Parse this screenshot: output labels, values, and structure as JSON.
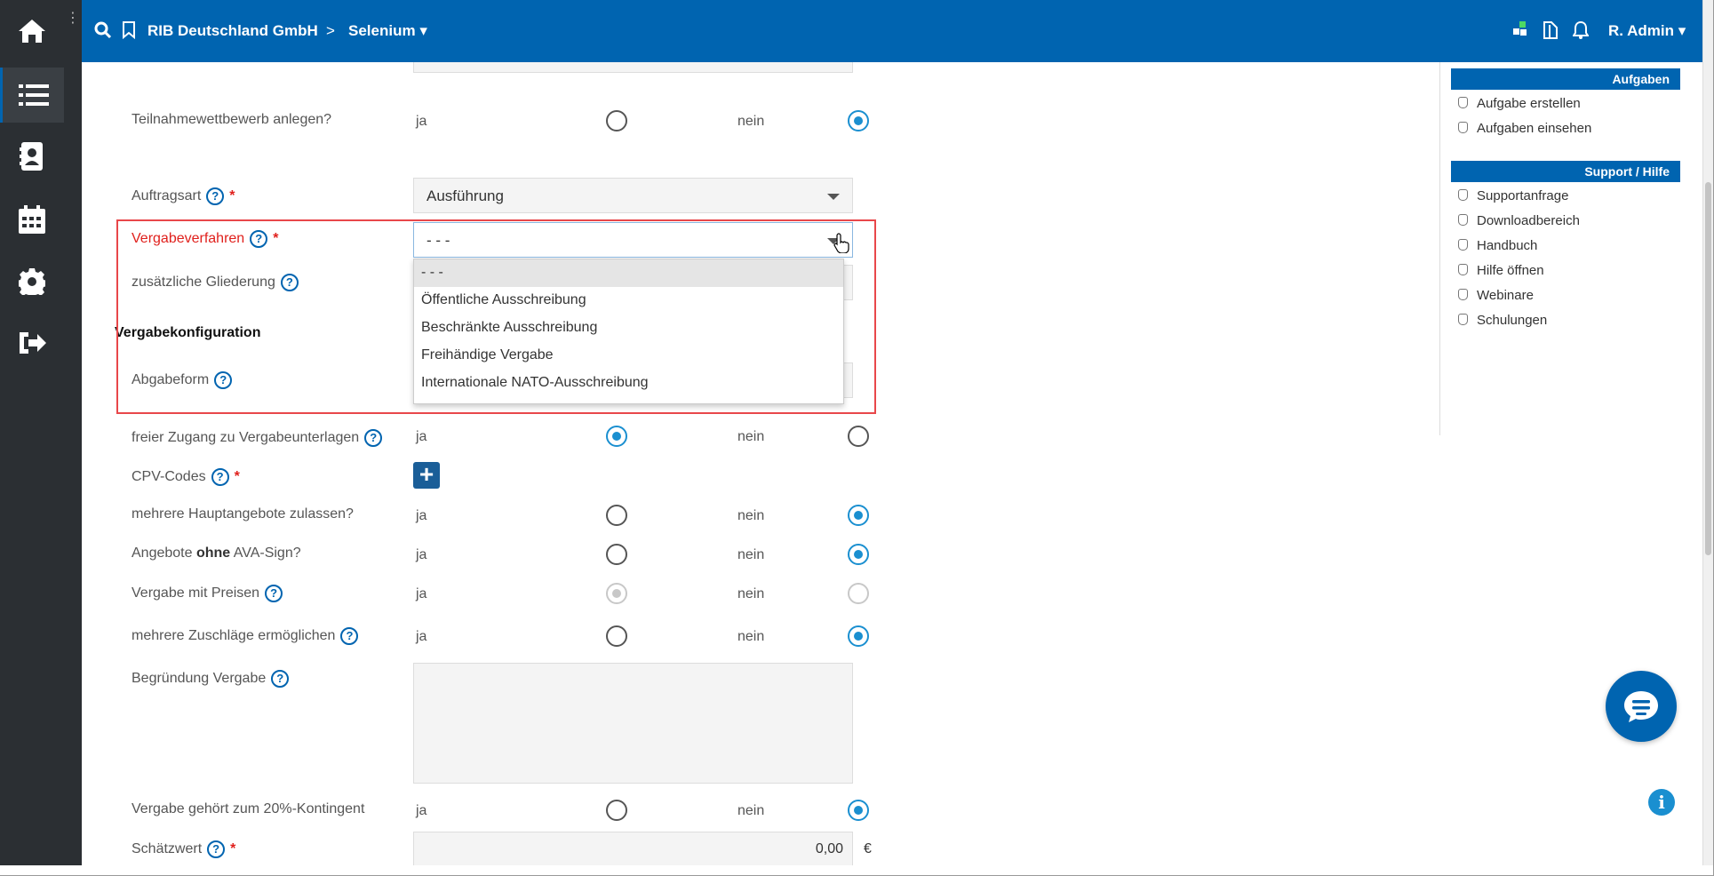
{
  "header": {
    "company": "RIB Deutschland GmbH",
    "separator": ">",
    "project": "Selenium",
    "user": "R. Admin"
  },
  "sidebar": {
    "items": [
      {
        "icon": "home-icon"
      },
      {
        "icon": "list-icon",
        "active": true
      },
      {
        "icon": "contacts-icon"
      },
      {
        "icon": "calendar-icon"
      },
      {
        "icon": "settings-icon"
      },
      {
        "icon": "logout-icon"
      }
    ]
  },
  "form": {
    "teilnahme": {
      "label": "Teilnahmewettbewerb anlegen?",
      "yes": "ja",
      "no": "nein",
      "value": "nein"
    },
    "auftragsart": {
      "label": "Auftragsart",
      "value": "Ausführung"
    },
    "vergabeverfahren": {
      "label": "Vergabeverfahren",
      "value": "- - -"
    },
    "gliederung": {
      "label": "zusätzliche Gliederung"
    },
    "section_title": "Vergabekonfiguration",
    "abgabeform": {
      "label": "Abgabeform"
    },
    "zugang": {
      "label": "freier Zugang zu Vergabeunterlagen",
      "yes": "ja",
      "no": "nein",
      "value": "ja"
    },
    "cpv": {
      "label": "CPV-Codes",
      "add": "+"
    },
    "hauptangebote": {
      "label": "mehrere Hauptangebote zulassen?",
      "yes": "ja",
      "no": "nein",
      "value": "nein"
    },
    "avasign": {
      "label_pre": "Angebote ",
      "label_bold": "ohne",
      "label_post": " AVA-Sign?",
      "yes": "ja",
      "no": "nein",
      "value": "nein"
    },
    "preise": {
      "label": "Vergabe mit Preisen",
      "yes": "ja",
      "no": "nein",
      "value": "ja",
      "disabled": true
    },
    "zuschlaege": {
      "label": "mehrere Zuschläge ermöglichen",
      "yes": "ja",
      "no": "nein",
      "value": "nein"
    },
    "begruendung": {
      "label": "Begründung Vergabe"
    },
    "kontingent": {
      "label": "Vergabe gehört zum 20%-Kontingent",
      "yes": "ja",
      "no": "nein",
      "value": "nein"
    },
    "schaetzwert": {
      "label": "Schätzwert",
      "value": "0,00",
      "currency": "€"
    },
    "required_mark": "*",
    "help_mark": "?"
  },
  "dropdown": {
    "options": [
      "- - -",
      "Öffentliche Ausschreibung",
      "Beschränkte Ausschreibung",
      "Freihändige Vergabe",
      "Internationale NATO-Ausschreibung"
    ],
    "selected_index": 0
  },
  "right_panel": {
    "tasks_title": "Aufgaben",
    "tasks": [
      "Aufgabe erstellen",
      "Aufgaben einsehen"
    ],
    "support_title": "Support / Hilfe",
    "support": [
      "Supportanfrage",
      "Downloadbereich",
      "Handbuch",
      "Hilfe öffnen",
      "Webinare",
      "Schulungen"
    ]
  },
  "colors": {
    "brand": "#0064b0",
    "error": "#e0201c",
    "radio_on": "#1a8fd0",
    "sidebar": "#2b2f33"
  }
}
